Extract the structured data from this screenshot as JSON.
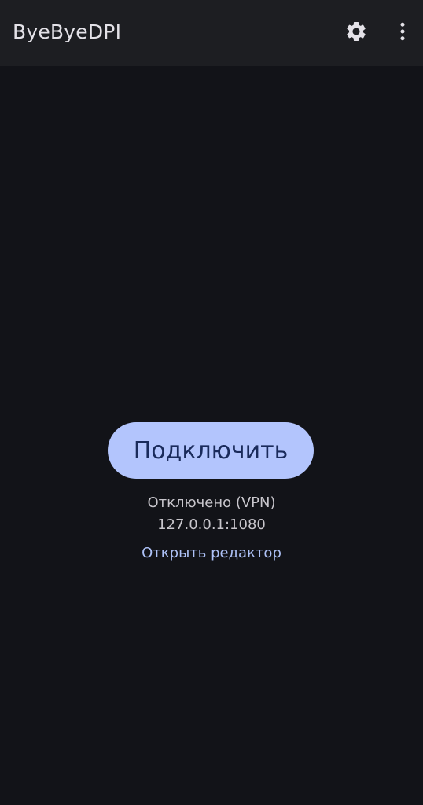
{
  "app_bar": {
    "title": "ByeByeDPI",
    "settings_icon": "gear-icon",
    "overflow_icon": "more-vert-icon"
  },
  "main": {
    "connect_label": "Подключить",
    "status": "Отключено (VPN)",
    "address": "127.0.0.1:1080",
    "editor_link": "Открыть редактор"
  },
  "colors": {
    "background": "#121318",
    "app_bar": "#1d1e22",
    "button_bg": "#b3c5fd",
    "button_text": "#1a2b5b",
    "link": "#aec2f7",
    "text": "#c8c6cc"
  }
}
